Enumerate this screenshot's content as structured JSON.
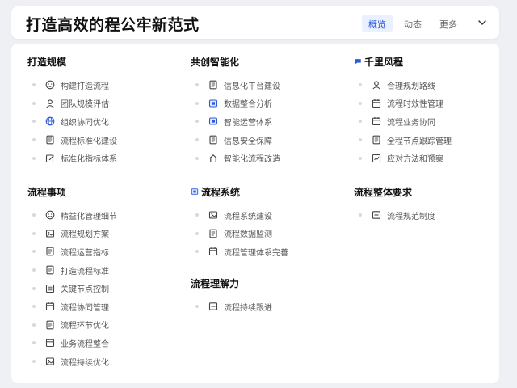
{
  "header": {
    "title": "打造高效的程公牢新范式",
    "tabs": [
      {
        "label": "概览",
        "active": true
      },
      {
        "label": "动态",
        "active": false
      },
      {
        "label": "更多",
        "active": false
      }
    ]
  },
  "sections": [
    {
      "title": "打造规模",
      "items": [
        {
          "label": "构建打造流程",
          "icon": "smile-icon"
        },
        {
          "label": "团队规模评估",
          "icon": "user-icon"
        },
        {
          "label": "组织协同优化",
          "icon": "globe-icon"
        },
        {
          "label": "流程标准化建设",
          "icon": "doc-icon"
        },
        {
          "label": "标准化指标体系",
          "icon": "edit-icon"
        }
      ]
    },
    {
      "title": "共创智能化",
      "items": [
        {
          "label": "信息化平台建设",
          "icon": "doc-icon"
        },
        {
          "label": "数据整合分析",
          "icon": "chip-icon"
        },
        {
          "label": "智能运营体系",
          "icon": "chip-icon"
        },
        {
          "label": "信息安全保障",
          "icon": "doc-icon"
        },
        {
          "label": "智能化流程改造",
          "icon": "home-icon"
        }
      ]
    },
    {
      "title": "千里风程",
      "icon": "chat-icon",
      "items": [
        {
          "label": "合理规划路线",
          "icon": "user-icon"
        },
        {
          "label": "流程时效性管理",
          "icon": "calendar-icon"
        },
        {
          "label": "流程业务协同",
          "icon": "calendar-icon"
        },
        {
          "label": "全程节点跟踪管理",
          "icon": "doc-icon"
        },
        {
          "label": "应对方法和预案",
          "icon": "chart-icon"
        }
      ]
    },
    {
      "title": "流程事项",
      "items": [
        {
          "label": "精益化管理细节",
          "icon": "smile-icon"
        },
        {
          "label": "流程规划方案",
          "icon": "image-icon"
        },
        {
          "label": "流程运营指标",
          "icon": "doc-icon"
        },
        {
          "label": "打造流程标准",
          "icon": "doc-icon"
        },
        {
          "label": "关键节点控制",
          "icon": "list-icon"
        },
        {
          "label": "流程协同管理",
          "icon": "calendar-icon"
        },
        {
          "label": "流程环节优化",
          "icon": "doc-icon"
        },
        {
          "label": "业务流程整合",
          "icon": "calendar-icon"
        },
        {
          "label": "流程持续优化",
          "icon": "image-icon"
        }
      ]
    },
    {
      "title": "流程系统",
      "icon": "chip-icon",
      "items": [
        {
          "label": "流程系统建设",
          "icon": "image-icon"
        },
        {
          "label": "流程数据监测",
          "icon": "doc-icon"
        },
        {
          "label": "流程管理体系完善",
          "icon": "calendar-icon"
        }
      ]
    },
    {
      "title": "流程整体要求",
      "items": [
        {
          "label": "流程规范制度",
          "icon": "minus-icon"
        }
      ]
    },
    {
      "title": "流程理解力",
      "items": [
        {
          "label": "流程持续跟进",
          "icon": "minus-icon"
        }
      ]
    }
  ],
  "colors": {
    "accent": "#2e5bd8",
    "icon_gray": "#444444"
  }
}
